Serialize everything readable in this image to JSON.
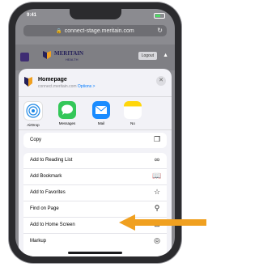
{
  "status_bar": {
    "time": "9:41"
  },
  "browser": {
    "url": "connect-stage.meritain.com",
    "reload_icon": "reload-icon"
  },
  "website": {
    "brand": "MERITAIN",
    "brand_sub": "HEALTH",
    "logout_label": "Logout"
  },
  "share_sheet": {
    "preview": {
      "title": "Homepage",
      "url": "connect.meritain.com",
      "options_label": "Options >"
    },
    "apps": [
      {
        "label": "AirDrop",
        "icon": "airdrop-icon",
        "color": "#1e88e5"
      },
      {
        "label": "Messages",
        "icon": "messages-icon",
        "color": "#34c759"
      },
      {
        "label": "Mail",
        "icon": "mail-icon",
        "color": "#1a8cff"
      },
      {
        "label": "No",
        "icon": "notes-icon",
        "color": "#ffd60a"
      }
    ],
    "copy_label": "Copy",
    "actions": [
      {
        "label": "Add to Reading List",
        "icon": "glasses-icon"
      },
      {
        "label": "Add Bookmark",
        "icon": "book-icon"
      },
      {
        "label": "Add to Favorites",
        "icon": "star-icon"
      },
      {
        "label": "Find on Page",
        "icon": "search-icon"
      },
      {
        "label": "Add to Home Screen",
        "icon": "add-square-icon"
      },
      {
        "label": "Markup",
        "icon": "markup-icon"
      }
    ]
  },
  "colors": {
    "arrow": "#f0a020",
    "accent": "#007aff"
  }
}
